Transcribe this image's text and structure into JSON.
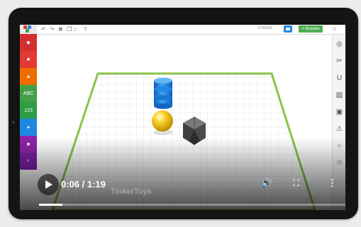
{
  "app": {
    "toolbar_icons": [
      "undo-icon",
      "redo-icon",
      "delete-icon",
      "copy-icon",
      "ruler-icon",
      "help-icon"
    ],
    "toolbar_glyphs": [
      "↶",
      "↷",
      "✖",
      "❐",
      "∕",
      "?"
    ],
    "title_text": "Untitled",
    "save_button_label": "✔ Bestellen",
    "home_glyph": "⌂"
  },
  "left_palette": [
    {
      "name": "shape-tool-red",
      "glyph": "◆",
      "color": "#d32f2f"
    },
    {
      "name": "shape-tool-red-2",
      "glyph": "■",
      "color": "#e53935"
    },
    {
      "name": "shape-tool-orange",
      "glyph": "▲",
      "color": "#ef6c00"
    },
    {
      "name": "text-tool",
      "glyph": "ABC",
      "color": "#43a047"
    },
    {
      "name": "number-tool",
      "glyph": "123",
      "color": "#2e9d46"
    },
    {
      "name": "shape-tool-blue",
      "glyph": "●",
      "color": "#1e88e5"
    },
    {
      "name": "shape-tool-purple",
      "glyph": "■",
      "color": "#8e24aa"
    },
    {
      "name": "search-tool",
      "glyph": "⌕",
      "color": "#7b1fa2"
    }
  ],
  "right_tools": [
    {
      "name": "view-icon",
      "glyph": "◎"
    },
    {
      "name": "cut-icon",
      "glyph": "✂"
    },
    {
      "name": "magnet-icon",
      "glyph": "U"
    },
    {
      "name": "group-icon",
      "glyph": "▨"
    },
    {
      "name": "duplicate-icon",
      "glyph": "▣"
    },
    {
      "name": "warning-icon",
      "glyph": "⚠"
    },
    {
      "name": "align-icon",
      "glyph": "○"
    },
    {
      "name": "trash-icon",
      "glyph": "♲"
    }
  ],
  "video": {
    "current_time": "0:06",
    "duration": "1:19",
    "time_display": "0:06 / 1:19",
    "progress": 0.076,
    "watermark": "TinkerToys",
    "volume_glyph": "🔊",
    "fullscreen_glyph": "⛶",
    "menu_glyph": "⋮"
  },
  "colors": {
    "grid_border": "#8bc34a",
    "cylinder": "#2196f3",
    "sphere": "#fdd835",
    "polyhedron": "#555555"
  }
}
